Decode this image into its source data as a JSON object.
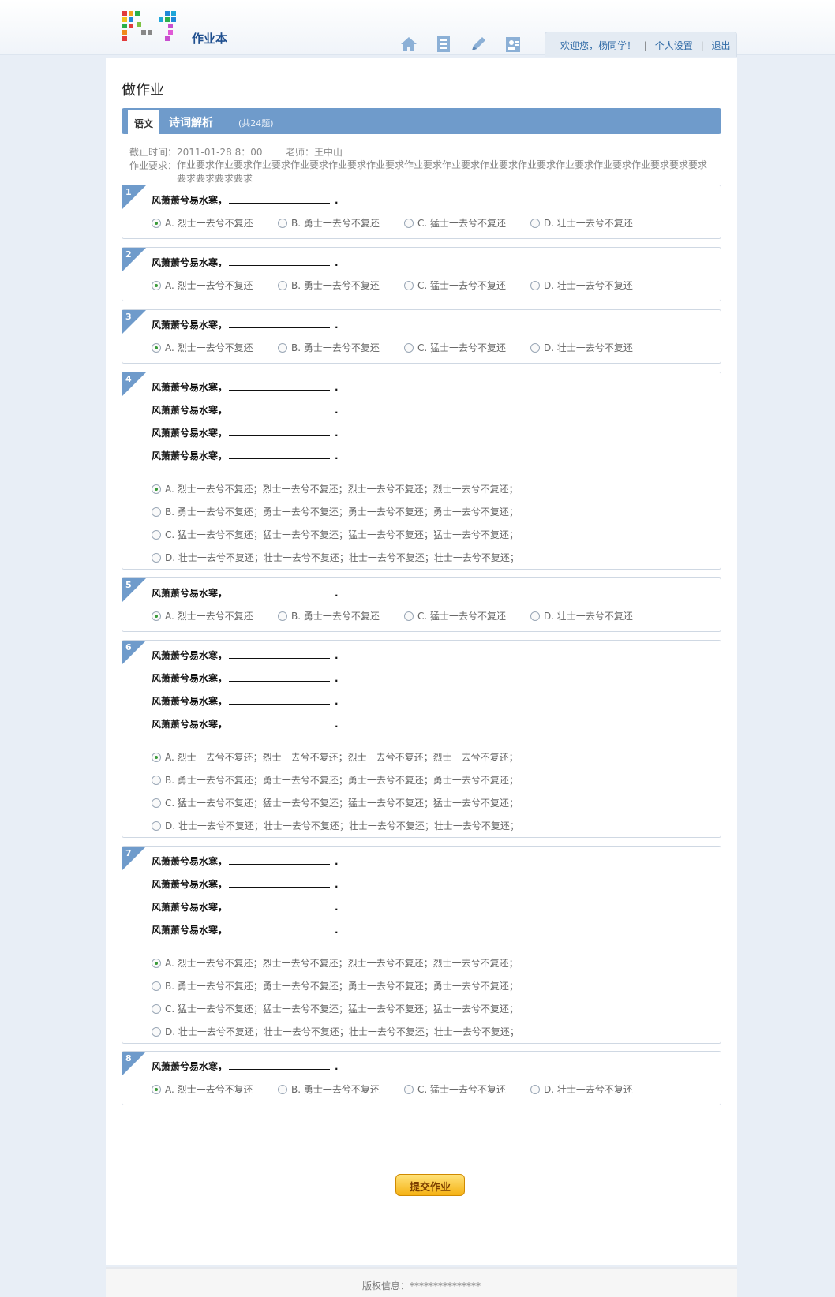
{
  "app": {
    "brand": "作业本"
  },
  "header": {
    "nav_icons": [
      "home-icon",
      "notebook-icon",
      "pencil-icon",
      "contacts-icon"
    ],
    "welcome": "欢迎您，杨同学！",
    "settings": "个人设置",
    "logout": "退出",
    "separator": "|"
  },
  "page": {
    "title": "做作业",
    "subject": "语文",
    "section": "诗词解析",
    "count": "(共24题)",
    "deadline_label": "截止时间：",
    "deadline": "2011-01-28 8：00",
    "teacher_label": "老师：",
    "teacher": "王中山",
    "requirement_label": "作业要求：",
    "requirement": "作业要求作业要求作业要求作业要求作业要求作业要求作业要求作业要求作业要求作业要求作业要求作业要求作业要求要求要求要求要求要求要求"
  },
  "stem_text": "风萧萧兮易水寒，",
  "stem_end": ".",
  "questions": [
    {
      "num": "1",
      "options": [
        "A.  烈士一去兮不复还",
        "B.  勇士一去兮不复还",
        "C.  猛士一去兮不复还",
        "D.  壮士一去兮不复还"
      ]
    },
    {
      "num": "2",
      "options": [
        "A.  烈士一去兮不复还",
        "B.  勇士一去兮不复还",
        "C.  猛士一去兮不复还",
        "D.  壮士一去兮不复还"
      ]
    },
    {
      "num": "3",
      "options": [
        "A.  烈士一去兮不复还",
        "B.  勇士一去兮不复还",
        "C.  猛士一去兮不复还",
        "D.  壮士一去兮不复还"
      ]
    },
    {
      "num": "4",
      "options": [
        "A.  烈士一去兮不复还；烈士一去兮不复还；烈士一去兮不复还；烈士一去兮不复还；",
        "B.  勇士一去兮不复还；勇士一去兮不复还；勇士一去兮不复还；勇士一去兮不复还；",
        "C.  猛士一去兮不复还；猛士一去兮不复还；猛士一去兮不复还；猛士一去兮不复还；",
        "D.  壮士一去兮不复还；壮士一去兮不复还；壮士一去兮不复还；壮士一去兮不复还；"
      ]
    },
    {
      "num": "5",
      "options": [
        "A.  烈士一去兮不复还",
        "B.  勇士一去兮不复还",
        "C.  猛士一去兮不复还",
        "D.  壮士一去兮不复还"
      ]
    },
    {
      "num": "6",
      "options": [
        "A.  烈士一去兮不复还；烈士一去兮不复还；烈士一去兮不复还；烈士一去兮不复还；",
        "B.  勇士一去兮不复还；勇士一去兮不复还；勇士一去兮不复还；勇士一去兮不复还；",
        "C.  猛士一去兮不复还；猛士一去兮不复还；猛士一去兮不复还；猛士一去兮不复还；",
        "D.  壮士一去兮不复还；壮士一去兮不复还；壮士一去兮不复还；壮士一去兮不复还；"
      ]
    },
    {
      "num": "7",
      "options": [
        "A.  烈士一去兮不复还；烈士一去兮不复还；烈士一去兮不复还；烈士一去兮不复还；",
        "B.  勇士一去兮不复还；勇士一去兮不复还；勇士一去兮不复还；勇士一去兮不复还；",
        "C.  猛士一去兮不复还；猛士一去兮不复还；猛士一去兮不复还；猛士一去兮不复还；",
        "D.  壮士一去兮不复还；壮士一去兮不复还；壮士一去兮不复还；壮士一去兮不复还；"
      ]
    },
    {
      "num": "8",
      "options": [
        "A.  烈士一去兮不复还",
        "B.  勇士一去兮不复还",
        "C.  猛士一去兮不复还",
        "D.  壮士一去兮不复还"
      ]
    }
  ],
  "selected_option": "A",
  "submit_label": "提交作业",
  "footer": {
    "copyright": "版权信息：***************"
  },
  "colors": {
    "accent": "#6f9bcb",
    "link": "#2f6aa6",
    "submit": "#f5b214"
  }
}
